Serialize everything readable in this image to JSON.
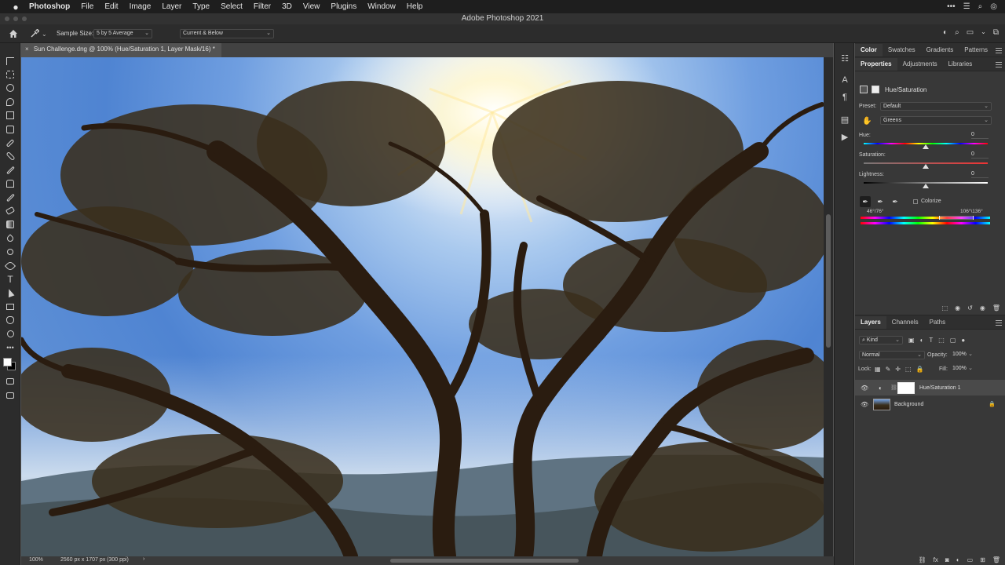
{
  "menubar": {
    "apple_icon": "",
    "items": [
      "Photoshop",
      "File",
      "Edit",
      "Image",
      "Layer",
      "Type",
      "Select",
      "Filter",
      "3D",
      "View",
      "Plugins",
      "Window",
      "Help"
    ]
  },
  "window": {
    "title": "Adobe Photoshop 2021"
  },
  "options": {
    "sample_size_label": "Sample Size:",
    "sample_size_value": "5 by 5 Average",
    "sample_layers_value": "Current & Below"
  },
  "document": {
    "tab_title": "Sun Challenge.dng @ 100% (Hue/Saturation 1, Layer Mask/16) *",
    "close_glyph": "×"
  },
  "status": {
    "zoom": "100%",
    "doc_info": "2560 px x 1707 px (300 ppi)",
    "arrow": "›"
  },
  "panels": {
    "color_tabs": [
      "Color",
      "Swatches",
      "Gradients",
      "Patterns"
    ],
    "properties_tabs": [
      "Properties",
      "Adjustments",
      "Libraries"
    ],
    "layers_tabs": [
      "Layers",
      "Channels",
      "Paths"
    ]
  },
  "properties": {
    "adjustment_name": "Hue/Saturation",
    "preset_label": "Preset:",
    "preset_value": "Default",
    "channel_value": "Greens",
    "hue_label": "Hue:",
    "hue_value": "0",
    "saturation_label": "Saturation:",
    "saturation_value": "0",
    "lightness_label": "Lightness:",
    "lightness_value": "0",
    "colorize_label": "Colorize",
    "range_left": "46°/76°",
    "range_right": "106°\\136°"
  },
  "layers": {
    "filter_kind": "Kind",
    "blend_mode": "Normal",
    "opacity_label": "Opacity:",
    "opacity_value": "100%",
    "lock_label": "Lock:",
    "fill_label": "Fill:",
    "fill_value": "100%",
    "items": [
      {
        "name": "Hue/Saturation 1"
      },
      {
        "name": "Background"
      }
    ]
  },
  "icons": {
    "eye": "👁",
    "lock": "🔒",
    "chevron": "⌄",
    "fx": "fx"
  },
  "colors": {
    "panel_bg": "#383838",
    "toolbar_bg": "#2c2c2c",
    "menubar_bg": "#1e1e1e",
    "sky": "#5c8ed5"
  }
}
